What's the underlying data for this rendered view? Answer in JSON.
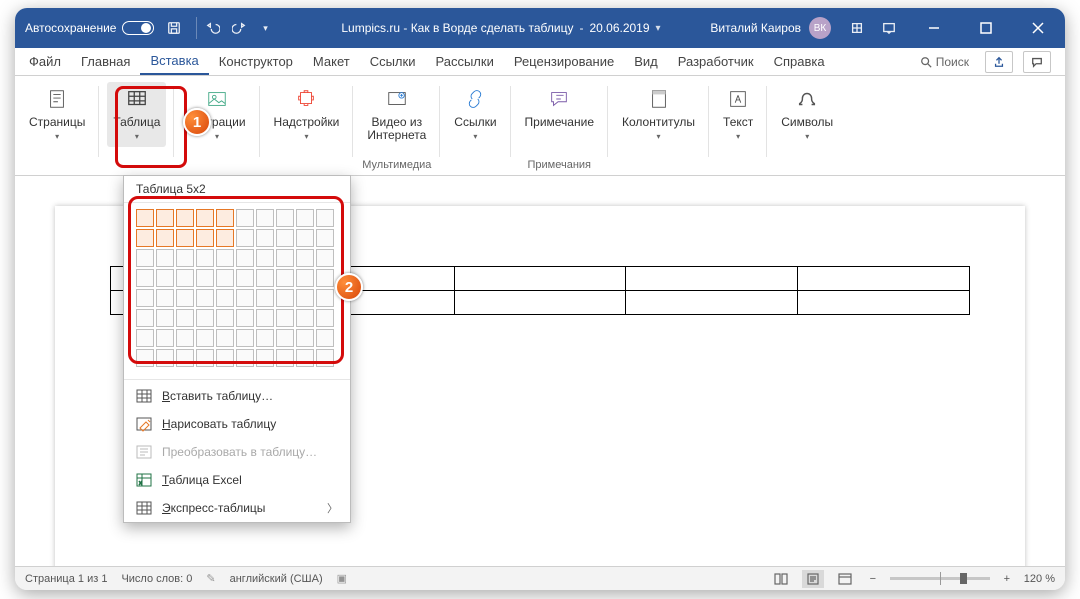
{
  "titlebar": {
    "autosave_label": "Автосохранение",
    "doc_title": "Lumpics.ru - Как в Ворде сделать таблицу",
    "doc_date": "20.06.2019",
    "user_name": "Виталий Каиров",
    "user_initials": "ВК"
  },
  "tabs": {
    "items": [
      {
        "label": "Файл"
      },
      {
        "label": "Главная"
      },
      {
        "label": "Вставка",
        "active": true
      },
      {
        "label": "Конструктор"
      },
      {
        "label": "Макет"
      },
      {
        "label": "Ссылки"
      },
      {
        "label": "Рассылки"
      },
      {
        "label": "Рецензирование"
      },
      {
        "label": "Вид"
      },
      {
        "label": "Разработчик"
      },
      {
        "label": "Справка"
      }
    ],
    "search_label": "Поиск"
  },
  "ribbon": {
    "pages": {
      "big": "Страницы"
    },
    "table": {
      "big": "Таблица"
    },
    "illustrations": {
      "big": "…страции"
    },
    "addins": {
      "big": "Надстройки"
    },
    "media": {
      "big": "Видео из\nИнтернета",
      "group": "Мультимедиа"
    },
    "links": {
      "big": "Ссылки"
    },
    "comment": {
      "big": "Примечание",
      "group": "Примечания"
    },
    "headers": {
      "big": "Колонтитулы"
    },
    "text": {
      "big": "Текст"
    },
    "symbols": {
      "big": "Символы"
    }
  },
  "table_menu": {
    "title": "Таблица 5x2",
    "grid_cols": 10,
    "grid_rows": 8,
    "sel_cols": 5,
    "sel_rows": 2,
    "items": [
      {
        "label": "Вставить таблицу…",
        "icon": "table-grid"
      },
      {
        "label": "Нарисовать таблицу",
        "icon": "table-draw"
      },
      {
        "label": "Преобразовать в таблицу…",
        "icon": "table-convert",
        "disabled": true
      },
      {
        "label": "Таблица Excel",
        "icon": "table-excel"
      },
      {
        "label": "Экспресс-таблицы",
        "icon": "table-quick",
        "submenu": true
      }
    ]
  },
  "doc": {
    "table_cols": 5,
    "table_rows": 2
  },
  "statusbar": {
    "page": "Страница 1 из 1",
    "words": "Число слов: 0",
    "lang": "английский (США)",
    "zoom": "120 %"
  },
  "badges": {
    "one": "1",
    "two": "2"
  }
}
